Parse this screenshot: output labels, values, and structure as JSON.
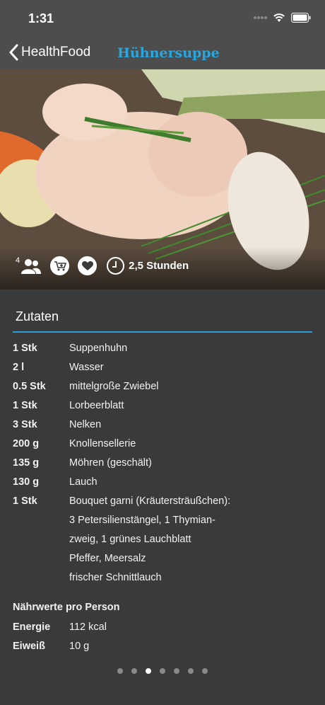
{
  "status": {
    "time": "1:31"
  },
  "nav": {
    "back_label": "HealthFood",
    "title": "Hühnersuppe"
  },
  "recipe": {
    "servings": "4",
    "duration": "2,5 Stunden"
  },
  "ingredients": {
    "title": "Zutaten",
    "items": [
      {
        "qty": "1 Stk",
        "name": "Suppenhuhn"
      },
      {
        "qty": "2 l",
        "name": "Wasser"
      },
      {
        "qty": "0.5 Stk",
        "name": "mittelgroße Zwiebel"
      },
      {
        "qty": "1 Stk",
        "name": "Lorbeerblatt"
      },
      {
        "qty": "3 Stk",
        "name": "Nelken"
      },
      {
        "qty": "200 g",
        "name": "Knollensellerie"
      },
      {
        "qty": "135 g",
        "name": "Möhren (geschält)"
      },
      {
        "qty": "130 g",
        "name": "Lauch"
      },
      {
        "qty": "1 Stk",
        "name": "Bouquet garni (Kräutersträußchen):"
      }
    ],
    "extra_lines": [
      "3 Petersilienstängel, 1 Thymian-",
      "zweig, 1 grünes Lauchblatt",
      "Pfeffer, Meersalz",
      "frischer Schnittlauch"
    ]
  },
  "nutrition": {
    "title": "Nährwerte pro Person",
    "items": [
      {
        "label": "Energie",
        "value": "112 kcal"
      },
      {
        "label": "Eiweiß",
        "value": "10 g"
      }
    ]
  },
  "pager": {
    "count": 7,
    "active_index": 2
  },
  "colors": {
    "accent": "#29a7e0",
    "background": "#3a3a3a",
    "bar": "#4d4d4d"
  }
}
